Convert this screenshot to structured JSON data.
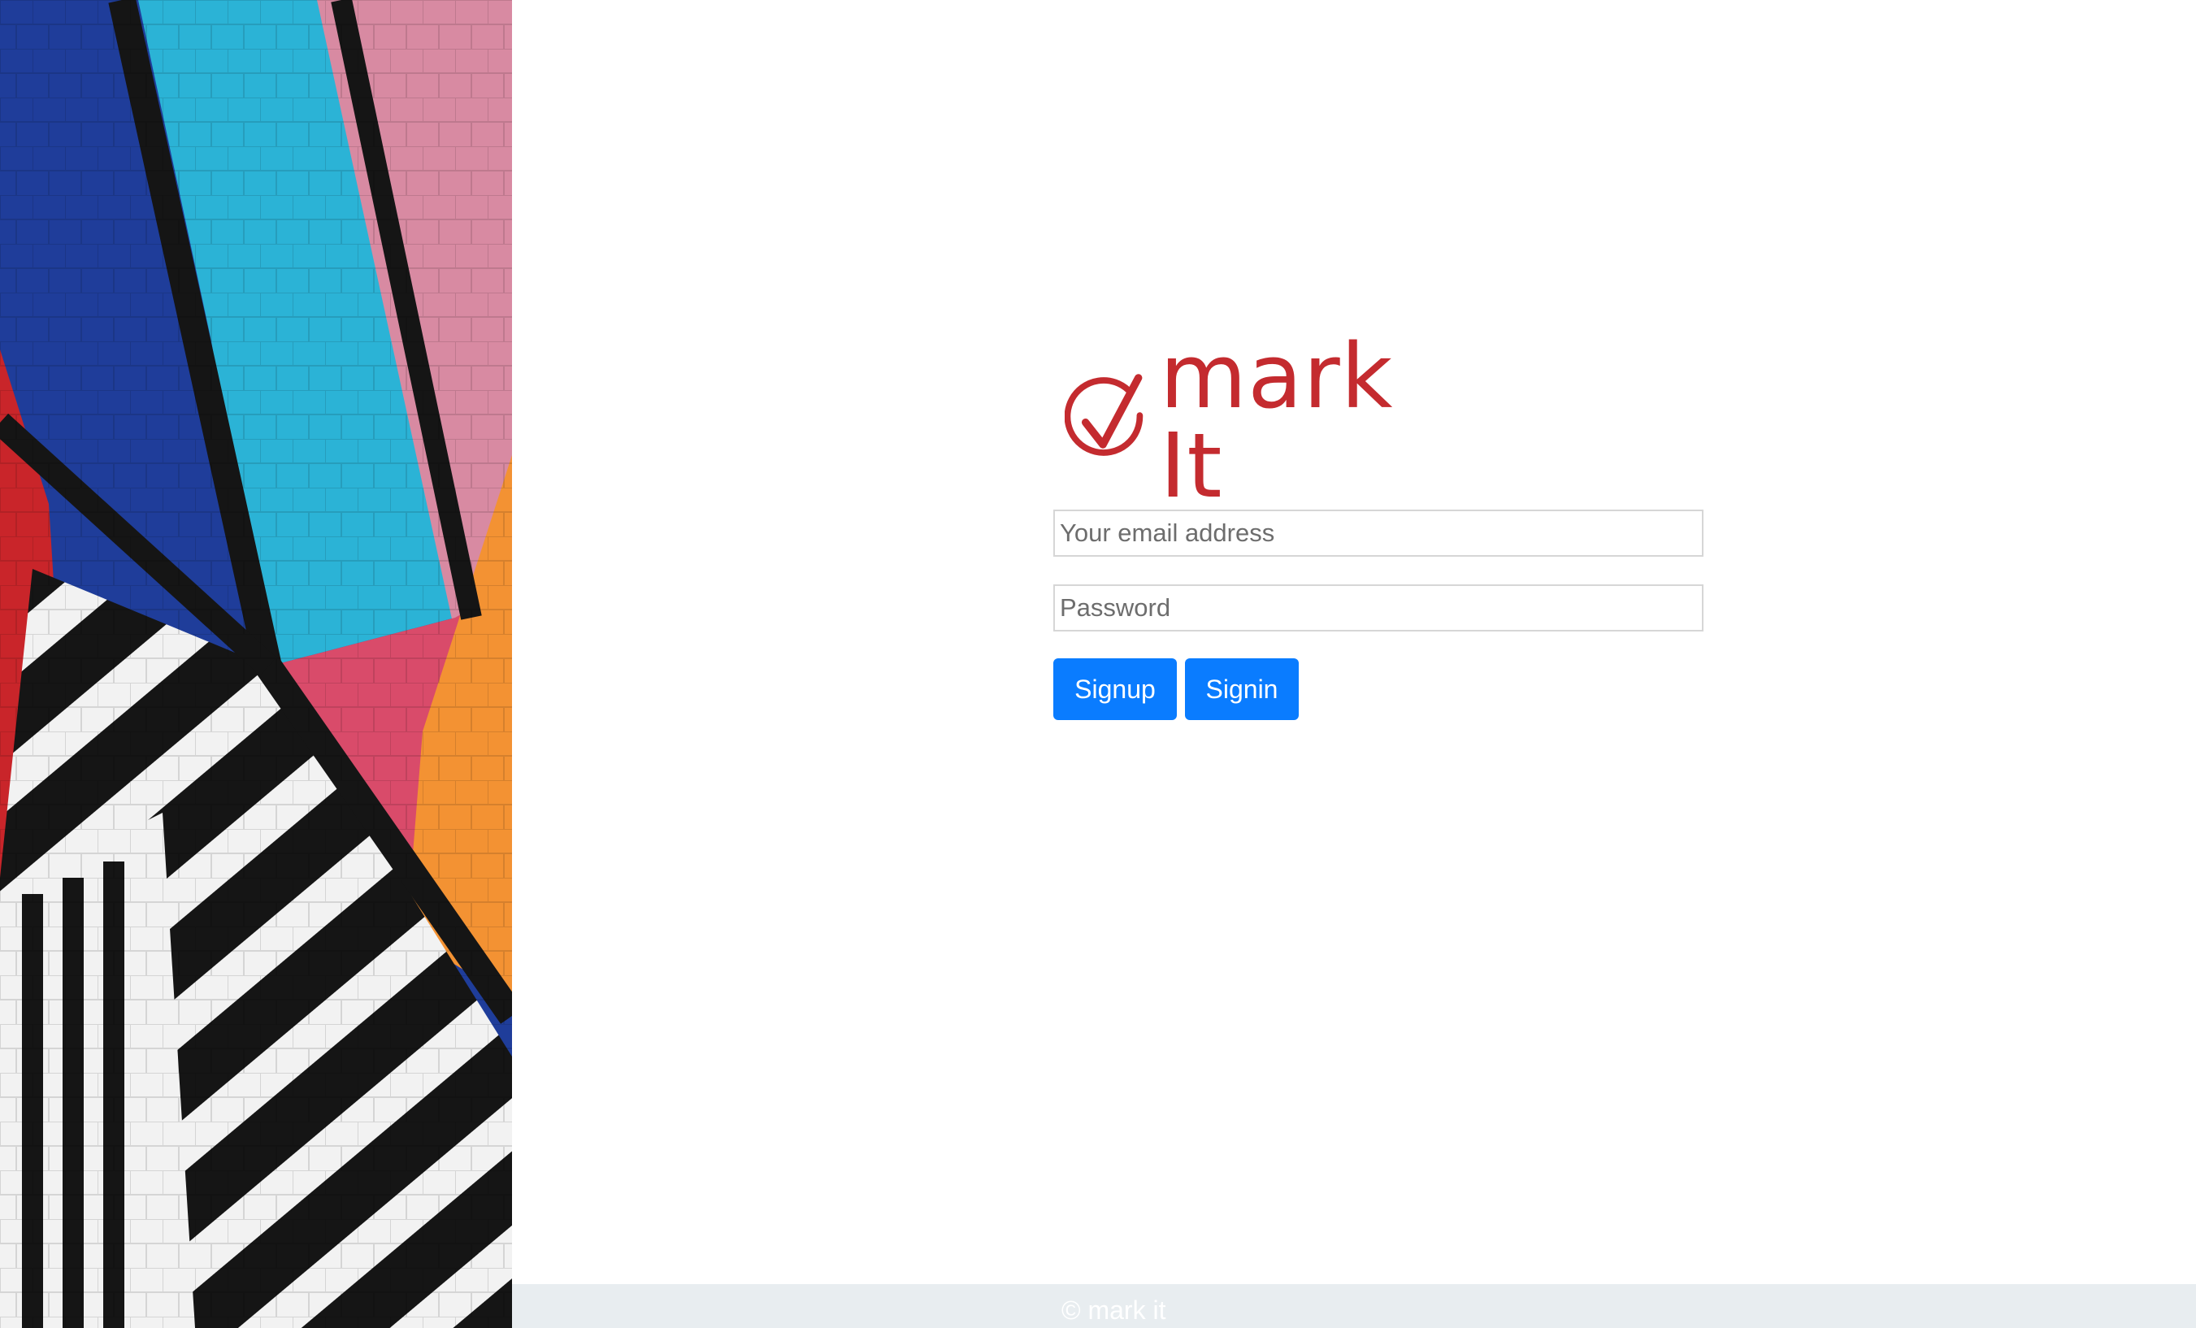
{
  "brand": {
    "name": "mark It",
    "color": "#c42b2f"
  },
  "login_form": {
    "email_placeholder": "Your email address",
    "password_placeholder": "Password",
    "signup_label": "Signup",
    "signin_label": "Signin",
    "button_color": "#0a7cff"
  },
  "footer": {
    "text": "© mark it"
  },
  "side_image": {
    "description_icon": "colorful-brick-mural-image"
  }
}
